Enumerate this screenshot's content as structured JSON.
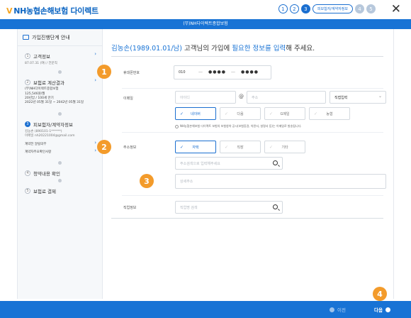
{
  "header": {
    "logo_mark": "V",
    "logo_text": "NH농협손해보험 다이렉트",
    "steps": [
      "1",
      "2",
      "3",
      "4",
      "5"
    ],
    "active_step_label": "피보험자/계약자정보",
    "close_symbol": "✕"
  },
  "banner": {
    "title": "(무)NH다이렉트종합보험"
  },
  "sidebar": {
    "heading": "가입진행단계 안내",
    "s1": {
      "num": "1",
      "title": "고객정보",
      "sub": "87.07.31 (여) / 전문직"
    },
    "s2": {
      "num": "2",
      "title": "보험료 계산결과",
      "lines": [
        "(무)NH다이렉트종합보험",
        "125,546원/월",
        "20년납 / 100세 만기",
        "2022년 05월 31일 ~ 2042년 05월 31일"
      ]
    },
    "s3": {
      "num": "3",
      "title": "피보험자/계약자정보",
      "lines": [
        "김농손 (890101-1******)",
        "이메일 nh20221004@gmail.com"
      ],
      "link1": "계약전 알릴의무",
      "link2": "계약자주요확인사항"
    },
    "s4": {
      "num": "4",
      "title": "청약내용 확인"
    },
    "s5": {
      "num": "5",
      "title": "보험료 결제"
    },
    "chevron": "›"
  },
  "main": {
    "headline_name": "김농손(1989.01.01/남)",
    "headline_mid": " 고객님의 가입에 ",
    "headline_emph": "필요한 정보를 입력",
    "headline_end": "해 주세요.",
    "phone": {
      "label": "휴대폰번호",
      "prefix": "010",
      "mid": "●●●●",
      "last": "●●●●",
      "dash": "—"
    },
    "email": {
      "label": "이메일",
      "id_placeholder": "아이디",
      "at": "@",
      "domain_placeholder": "주소",
      "select_value": "직접입력",
      "chevron": "⌄",
      "options": [
        "네이버",
        "다음",
        "G메일",
        "농협"
      ],
      "check": "✓",
      "note": "NH농협손해보험 다이렉트 보험의 보험청약 공시(보험증권, 약관서, 설명서 등)는 이메일로 발송됩니다."
    },
    "address": {
      "label": "주소정보",
      "options": [
        "자택",
        "직장",
        "기타"
      ],
      "search_placeholder": "주소검색으로 입력해주세요",
      "detail_placeholder": "상세주소"
    },
    "job": {
      "label": "직업정보",
      "search_placeholder": "직업명 검색"
    }
  },
  "markers": [
    "1",
    "2",
    "3",
    "4"
  ],
  "footer": {
    "prev": "이전",
    "next": "다음"
  },
  "colors": {
    "primary": "#1873d5",
    "accent": "#f39b2b"
  }
}
